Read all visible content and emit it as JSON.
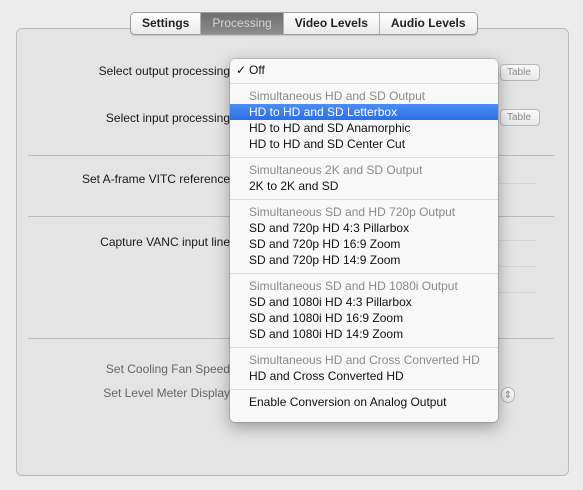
{
  "tabs": [
    {
      "label": "Settings",
      "selected": false
    },
    {
      "label": "Processing",
      "selected": true
    },
    {
      "label": "Video Levels",
      "selected": false
    },
    {
      "label": "Audio Levels",
      "selected": false
    }
  ],
  "rows": {
    "output_processing": "Select output processing",
    "input_processing": "Select input processing",
    "vitc_reference": "Set A-frame VITC reference",
    "vanc_input": "Capture VANC input line",
    "cooling_fan": "Set Cooling Fan Speed",
    "level_meter": "Set Level Meter Display"
  },
  "background_buttons": {
    "btn1": "Table",
    "btn2": "Table"
  },
  "menu": {
    "selected_value": "Off",
    "items": {
      "off": "Off",
      "h_hd_sd": "Simultaneous HD and SD Output",
      "letterbox": "HD to HD and SD Letterbox",
      "anamorphic": "HD to HD and SD Anamorphic",
      "center_cut": "HD to HD and SD Center Cut",
      "h_2k_sd": "Simultaneous 2K and SD Output",
      "2k_sd": "2K to 2K and SD",
      "h_sd_720": "Simultaneous SD and HD 720p Output",
      "720_pillar": "SD and 720p HD 4:3 Pillarbox",
      "720_169": "SD and 720p HD 16:9 Zoom",
      "720_149": "SD and 720p HD 14:9 Zoom",
      "h_sd_1080": "Simultaneous SD and HD 1080i Output",
      "1080_pillar": "SD and 1080i HD 4:3 Pillarbox",
      "1080_169": "SD and 1080i HD 16:9 Zoom",
      "1080_149": "SD and 1080i HD 14:9 Zoom",
      "h_cross": "Simultaneous HD and Cross Converted HD",
      "cross": "HD and Cross Converted HD",
      "analog": "Enable Conversion on Analog Output"
    },
    "highlighted": "HD to HD and SD Letterbox"
  },
  "colors": {
    "highlight": "#2b6fe6",
    "tab_selected": "#7d7d7d"
  }
}
